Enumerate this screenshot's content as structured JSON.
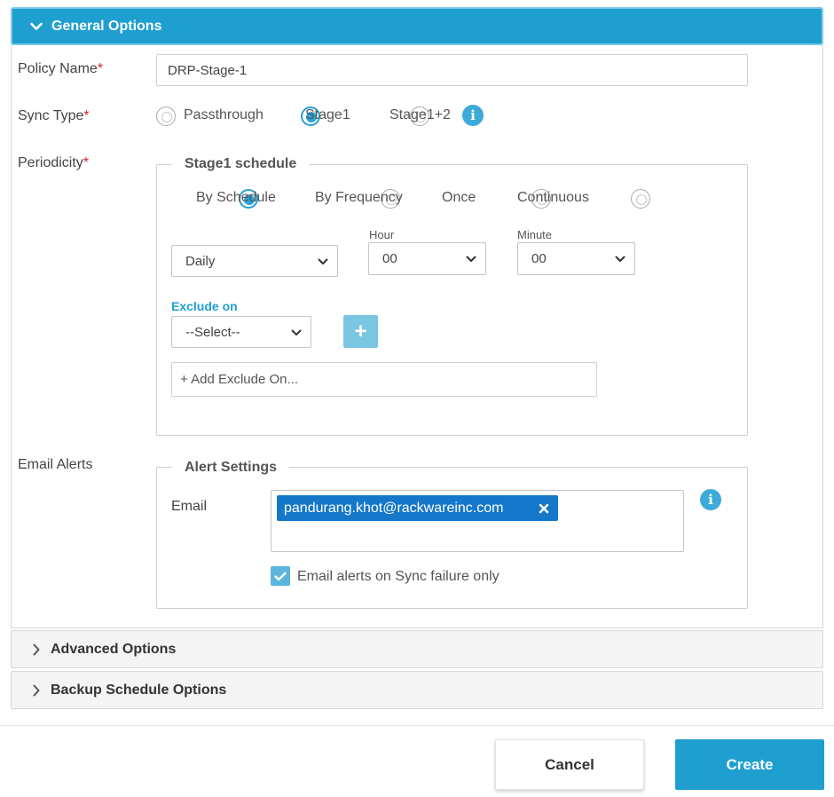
{
  "general_options": {
    "title": "General Options",
    "policy_name": {
      "label": "Policy Name",
      "required": "*",
      "value": "DRP-Stage-1"
    },
    "sync_type": {
      "label": "Sync Type",
      "required": "*",
      "options": [
        "Passthrough",
        "Stage1",
        "Stage1+2"
      ],
      "selected": "Stage1",
      "info_icon": "info-icon"
    },
    "periodicity": {
      "label": "Periodicity",
      "required": "*",
      "legend": "Stage1 schedule",
      "options": [
        "By Schedule",
        "By Frequency",
        "Once",
        "Continuous"
      ],
      "selected": "By Schedule",
      "frequency_value": "Daily",
      "hour_label": "Hour",
      "hour_value": "00",
      "minute_label": "Minute",
      "minute_value": "00",
      "exclude_label": "Exclude on",
      "exclude_select": "--Select--",
      "add_exclude_placeholder": "+ Add Exclude On..."
    },
    "email_alerts": {
      "label": "Email Alerts",
      "legend": "Alert Settings",
      "email_label": "Email",
      "email_tag": "pandurang.khot@rackwareinc.com",
      "checkbox_label": "Email alerts on Sync failure only",
      "checkbox_checked": true
    }
  },
  "advanced_options": {
    "title": "Advanced Options"
  },
  "backup_schedule_options": {
    "title": "Backup Schedule Options"
  },
  "footer": {
    "cancel_label": "Cancel",
    "create_label": "Create"
  },
  "colors": {
    "accent": "#1e9fd0",
    "required": "#d9232e",
    "tag": "#1577c9"
  }
}
